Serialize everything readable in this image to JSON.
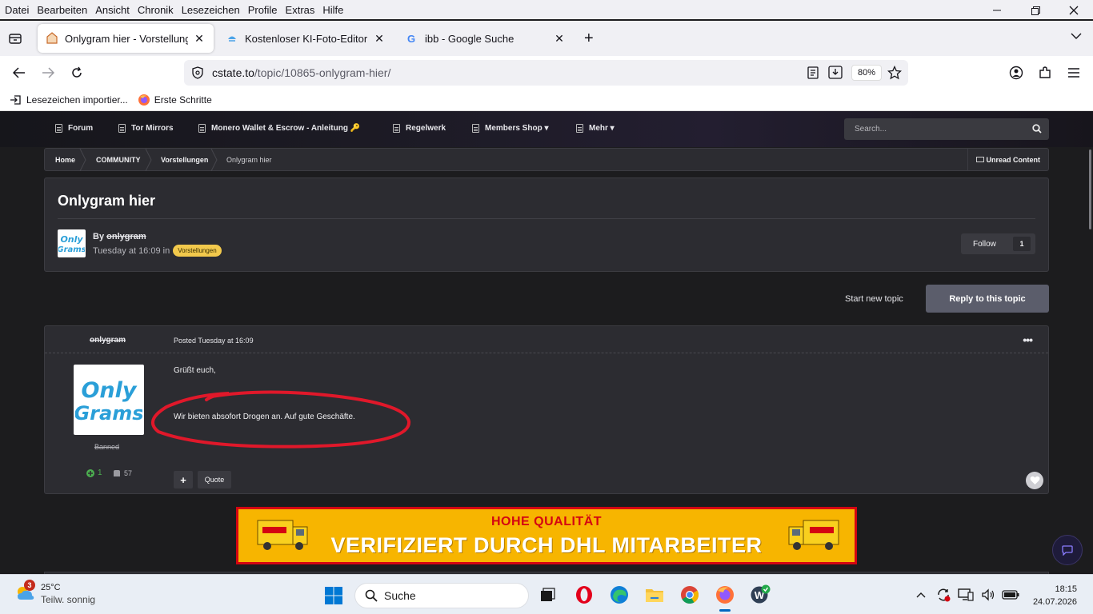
{
  "menubar": {
    "items": [
      "Datei",
      "Bearbeiten",
      "Ansicht",
      "Chronik",
      "Lesezeichen",
      "Profile",
      "Extras",
      "Hilfe"
    ]
  },
  "tabs": [
    {
      "title": "Onlygram hier - Vorstellungen - ",
      "active": true
    },
    {
      "title": "Kostenloser KI-Foto-Editor: Pixlr",
      "active": false
    },
    {
      "title": "ibb - Google Suche",
      "active": false
    }
  ],
  "navbar": {
    "url_domain": "cstate.to",
    "url_path": "/topic/10865-onlygram-hier/",
    "zoom": "80%"
  },
  "bookmarks": [
    {
      "label": "Lesezeichen importier...",
      "icon": "import-icon"
    },
    {
      "label": "Erste Schritte",
      "icon": "firefox-icon"
    }
  ],
  "site": {
    "nav": [
      {
        "label": "Forum"
      },
      {
        "label": "Tor Mirrors"
      },
      {
        "label": "Monero Wallet & Escrow - Anleitung 🔑"
      },
      {
        "label": "Regelwerk"
      },
      {
        "label": "Members Shop ▾"
      },
      {
        "label": "Mehr ▾"
      }
    ],
    "search_placeholder": "Search..."
  },
  "breadcrumb": {
    "items": [
      "Home",
      "COMMUNITY",
      "Vorstellungen",
      "Onlygram hier"
    ],
    "unread": "Unread Content"
  },
  "topic": {
    "title": "Onlygram hier",
    "by_prefix": "By",
    "author": "onlygram",
    "meta": "Tuesday at 16:09 in",
    "tag": "Vorstellungen",
    "follow_label": "Follow",
    "follow_count": "1",
    "avatar_text": "Only Grams"
  },
  "actions": {
    "start_new_topic": "Start new topic",
    "reply": "Reply to this topic"
  },
  "post": {
    "author": "onlygram",
    "posted": "Posted Tuesday at 16:09",
    "more": "•••",
    "rank": "Banned",
    "reputation": "1",
    "post_count": "57",
    "line1": "Grüßt euch,",
    "line2": "Wir bieten absofort Drogen an. Auf gute Geschäfte.",
    "plus": "+",
    "quote": "Quote"
  },
  "banner": {
    "line1": "HOHE QUALITÄT",
    "line2": "VERIFIZIERT DURCH DHL MITARBEITER",
    "colors": {
      "bg": "#f7b500",
      "accent": "#d40511"
    }
  },
  "taskbar": {
    "weather_temp": "25°C",
    "weather_cond": "Teilw. sonnig",
    "weather_badge": "3",
    "search": "Suche",
    "time": "18:15",
    "date": "24.07.2026"
  }
}
